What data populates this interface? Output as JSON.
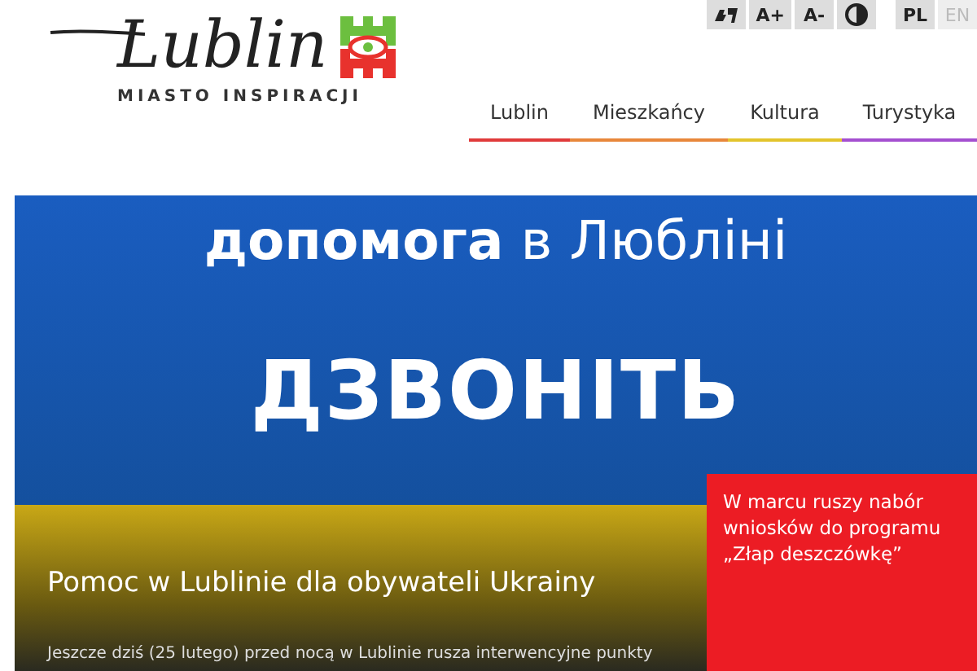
{
  "logo": {
    "wordmark": "Lublin",
    "tagline": "MIASTO INSPIRACJI"
  },
  "toolbar": {
    "buttons": [
      {
        "kind": "sign"
      },
      {
        "kind": "text",
        "label": "A+"
      },
      {
        "kind": "text",
        "label": "A-"
      },
      {
        "kind": "contrast"
      }
    ],
    "languages": [
      {
        "label": "PL",
        "selected": true
      },
      {
        "label": "EN",
        "selected": false
      }
    ]
  },
  "nav": [
    {
      "label": "Lublin",
      "color": "#e03a3a"
    },
    {
      "label": "Mieszkańcy",
      "color": "#e8873a"
    },
    {
      "label": "Kultura",
      "color": "#e3c42c"
    },
    {
      "label": "Turystyka",
      "color": "#a44fd0"
    }
  ],
  "banner": {
    "headline": "**допомога** в Любліні",
    "call": "ДЗВОНІТЬ",
    "title": "Pomoc w Lublinie dla obywateli Ukrainy",
    "lead": "Jeszcze dziś (25 lutego) przed nocą w Lublinie rusza interwencyjne punkty"
  },
  "promo": {
    "text": "W marcu ruszy nabór wniosków do programu „Złap deszczówkę”"
  }
}
